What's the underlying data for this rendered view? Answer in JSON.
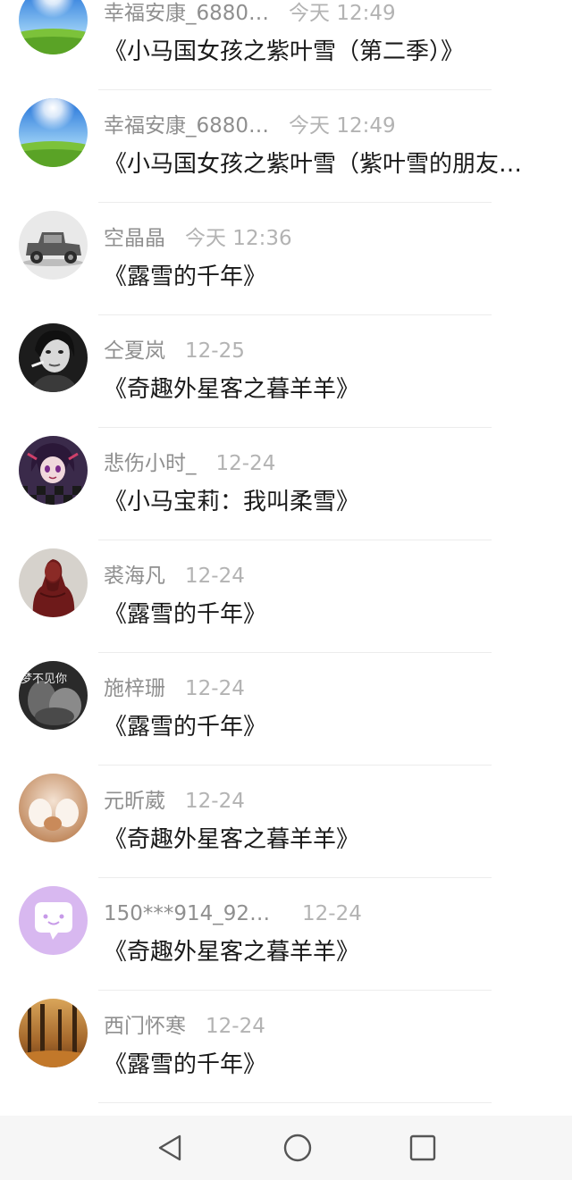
{
  "feed": [
    {
      "name": "幸福安康_6880…",
      "time": "今天 12:49",
      "title": "《小马国女孩之紫叶雪（第二季）》",
      "avatar_icon": "sky-grass-avatar-icon"
    },
    {
      "name": "幸福安康_6880…",
      "time": "今天 12:49",
      "title": "《小马国女孩之紫叶雪（紫叶雪的朋友…",
      "avatar_icon": "sky-grass-avatar-icon"
    },
    {
      "name": "空晶晶",
      "time": "今天 12:36",
      "title": "《露雪的千年》",
      "avatar_icon": "vintage-car-avatar-icon"
    },
    {
      "name": "仝夏岚",
      "time": "12-25",
      "title": "《奇趣外星客之暮羊羊》",
      "avatar_icon": "bw-portrait-avatar-icon"
    },
    {
      "name": "悲伤小时_",
      "time": "12-24",
      "title": "《小马宝莉：我叫柔雪》",
      "avatar_icon": "anime-character-avatar-icon"
    },
    {
      "name": "裘海凡",
      "time": "12-24",
      "title": "《露雪的千年》",
      "avatar_icon": "statue-avatar-icon"
    },
    {
      "name": "施梓珊",
      "time": "12-24",
      "title": "《露雪的千年》",
      "avatar_icon": "dark-collage-avatar-icon",
      "avatar_text": "梦不见你"
    },
    {
      "name": "元昕葳",
      "time": "12-24",
      "title": "《奇趣外星客之暮羊羊》",
      "avatar_icon": "cat-paws-avatar-icon"
    },
    {
      "name": "150***914_926…",
      "time": "12-24",
      "title": "《奇趣外星客之暮羊羊》",
      "avatar_icon": "chat-bubble-avatar-icon"
    },
    {
      "name": "西门怀寒",
      "time": "12-24",
      "title": "《露雪的千年》",
      "avatar_icon": "forest-avatar-icon"
    }
  ],
  "navbar": {
    "back_icon": "back-triangle-icon",
    "home_icon": "home-circle-icon",
    "recent_icon": "recent-square-icon"
  },
  "colors": {
    "name_text": "#8f8f8f",
    "time_text": "#b3b3b3",
    "title_text": "#1a1a1a",
    "navbar_bg": "#f6f6f6",
    "chat_avatar_bg": "#d8b8f0"
  }
}
